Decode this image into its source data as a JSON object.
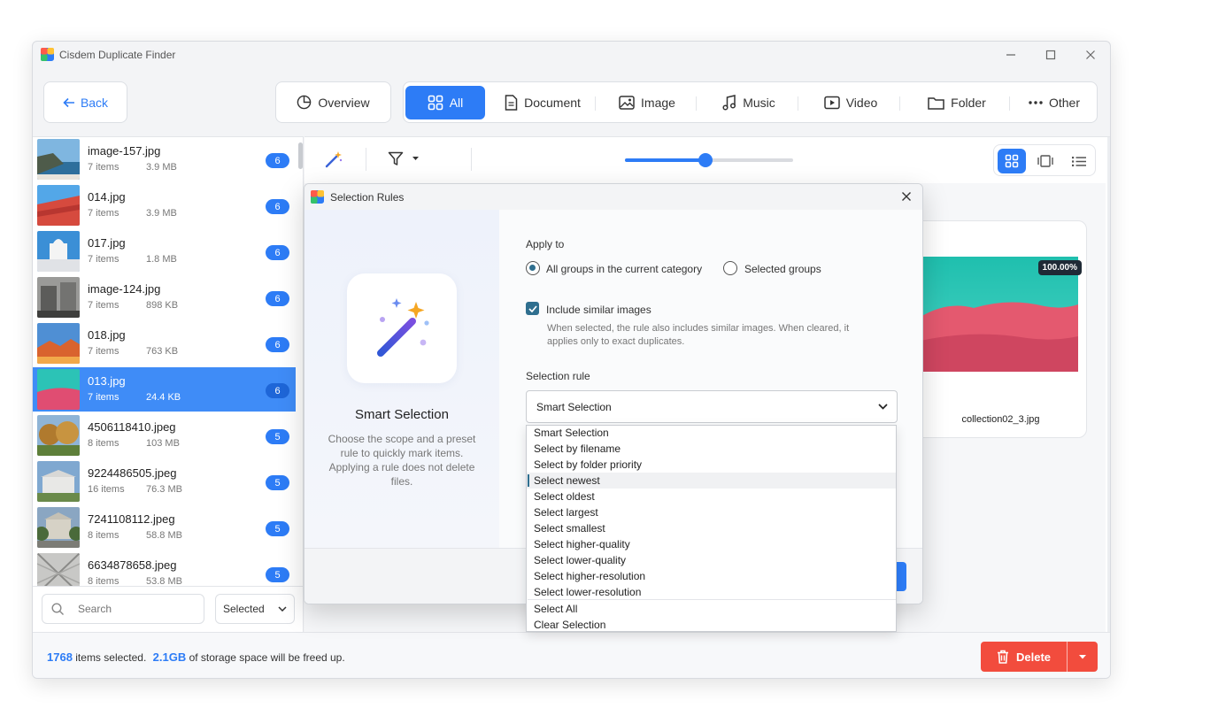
{
  "app": {
    "title": "Cisdem Duplicate Finder"
  },
  "nav": {
    "back_label": "Back",
    "overview_label": "Overview"
  },
  "categories": [
    {
      "label": "All",
      "icon": "grid-icon"
    },
    {
      "label": "Document",
      "icon": "document-icon"
    },
    {
      "label": "Image",
      "icon": "image-icon"
    },
    {
      "label": "Music",
      "icon": "music-icon"
    },
    {
      "label": "Video",
      "icon": "video-icon"
    },
    {
      "label": "Folder",
      "icon": "folder-icon"
    },
    {
      "label": "Other",
      "icon": "more-icon"
    }
  ],
  "sidebar": {
    "items": [
      {
        "name": "image-157.jpg",
        "count": "7 items",
        "size": "3.9 MB",
        "badge": "6"
      },
      {
        "name": "014.jpg",
        "count": "7 items",
        "size": "3.9 MB",
        "badge": "6"
      },
      {
        "name": "017.jpg",
        "count": "7 items",
        "size": "1.8 MB",
        "badge": "6"
      },
      {
        "name": "image-124.jpg",
        "count": "7 items",
        "size": "898 KB",
        "badge": "6"
      },
      {
        "name": "018.jpg",
        "count": "7 items",
        "size": "763 KB",
        "badge": "6"
      },
      {
        "name": "013.jpg",
        "count": "7 items",
        "size": "24.4 KB",
        "badge": "6"
      },
      {
        "name": "4506118410.jpeg",
        "count": "8 items",
        "size": "103 MB",
        "badge": "5"
      },
      {
        "name": "9224486505.jpeg",
        "count": "16 items",
        "size": "76.3 MB",
        "badge": "5"
      },
      {
        "name": "7241108112.jpeg",
        "count": "8 items",
        "size": "58.8 MB",
        "badge": "5"
      },
      {
        "name": "6634878658.jpeg",
        "count": "8 items",
        "size": "53.8 MB",
        "badge": "5"
      }
    ],
    "search_placeholder": "Search",
    "filter_value": "Selected"
  },
  "main": {
    "card": {
      "similarity": "100.00%",
      "filename": "collection02_3.jpg"
    }
  },
  "status": {
    "count": "1768",
    "count_suffix": "items selected.",
    "size": "2.1GB",
    "size_suffix": "of storage space will be freed up."
  },
  "delete_label": "Delete",
  "dialog": {
    "title": "Selection Rules",
    "heading": "Smart Selection",
    "description": "Choose the scope and a preset rule to quickly mark items. Applying a rule does not delete files.",
    "apply_to_label": "Apply to",
    "radio_all": "All groups in the current category",
    "radio_selected": "Selected groups",
    "include_similar_label": "Include similar images",
    "include_similar_hint": "When selected, the rule also includes similar images. When cleared, it applies only to exact duplicates.",
    "selection_rule_label": "Selection rule",
    "selection_rule_value": "Smart Selection",
    "options": [
      "Smart Selection",
      "Select by filename",
      "Select by folder priority",
      "Select newest",
      "Select oldest",
      "Select largest",
      "Select smallest",
      "Select higher-quality",
      "Select lower-quality",
      "Select higher-resolution",
      "Select lower-resolution"
    ],
    "extra_options": [
      "Select All",
      "Clear Selection"
    ]
  },
  "colors": {
    "accent": "#2d7cf6",
    "danger": "#f24c3d",
    "active_row": "#3f8cf7"
  }
}
